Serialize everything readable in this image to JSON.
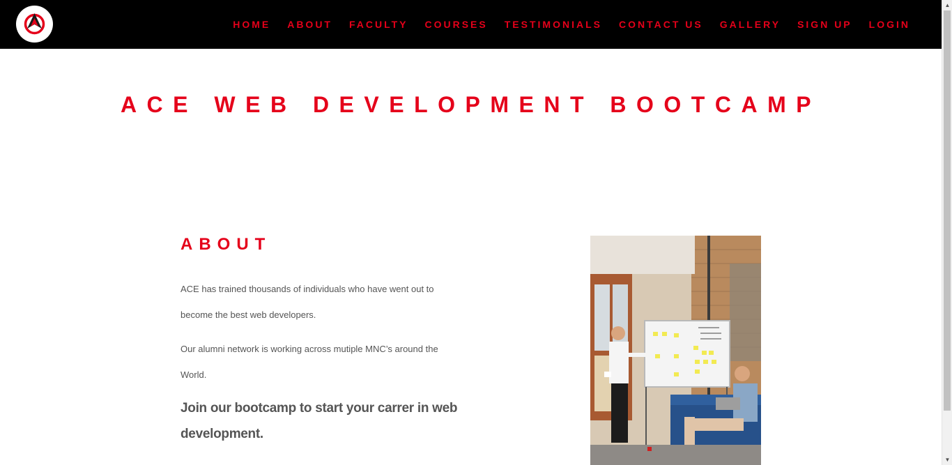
{
  "nav": {
    "items": [
      {
        "label": "HOME"
      },
      {
        "label": "ABOUT"
      },
      {
        "label": "FACULTY"
      },
      {
        "label": "COURSES"
      },
      {
        "label": "TESTIMONIALS"
      },
      {
        "label": "CONTACT US"
      },
      {
        "label": "GALLERY"
      },
      {
        "label": "SIGN UP"
      },
      {
        "label": "LOGIN"
      }
    ]
  },
  "hero": {
    "title": "ACE WEB DEVELOPMENT BOOTCAMP"
  },
  "about": {
    "heading": "ABOUT",
    "paragraph_1": "ACE has trained thousands of individuals who have went out to become the best web developers.",
    "paragraph_2": "Our alumni network is working across mutiple MNC’s around the World.",
    "cta": "Join our bootcamp to start your carrer in web development."
  },
  "colors": {
    "accent": "#e5001a",
    "navbar_bg": "#000000",
    "body_text": "#555555"
  },
  "icons": {
    "logo": "ace-logo-icon",
    "scroll_up": "triangle-up-icon",
    "scroll_down": "triangle-down-icon"
  }
}
